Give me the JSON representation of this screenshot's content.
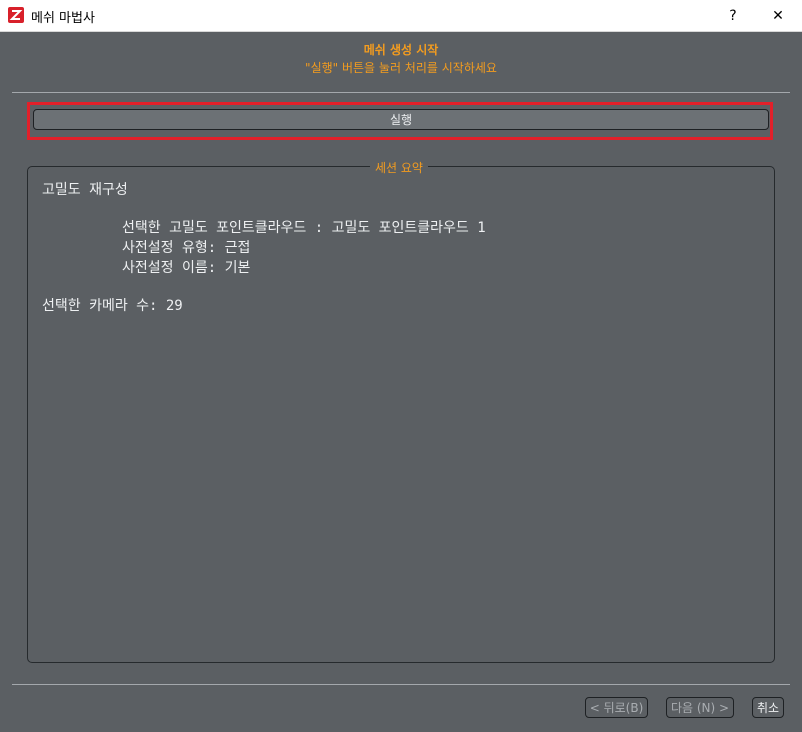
{
  "window": {
    "title": "메쉬 마법사",
    "help_label": "?",
    "close_label": "✕",
    "icon": "app-logo-icon"
  },
  "header": {
    "title": "메쉬 생성 시작",
    "subtitle": "\"실행\" 버튼을 눌러 처리를 시작하세요"
  },
  "run_button": {
    "label": "실행"
  },
  "summary": {
    "group_title": "세션 요약",
    "lines": [
      "고밀도 재구성",
      "선택한 고밀도 포인트클라우드 : 고밀도 포인트클라우드 1",
      "사전설정 유형: 근접",
      "사전설정 이름: 기본",
      "선택한 카메라 수: 29"
    ]
  },
  "footer": {
    "back_label": "< 뒤로(B)",
    "next_label": "다음 (N) >",
    "cancel_label": "취소"
  },
  "colors": {
    "background": "#5b5f63",
    "accent": "#f39c1f",
    "highlight": "#e2202a",
    "text": "#eef0f2"
  }
}
